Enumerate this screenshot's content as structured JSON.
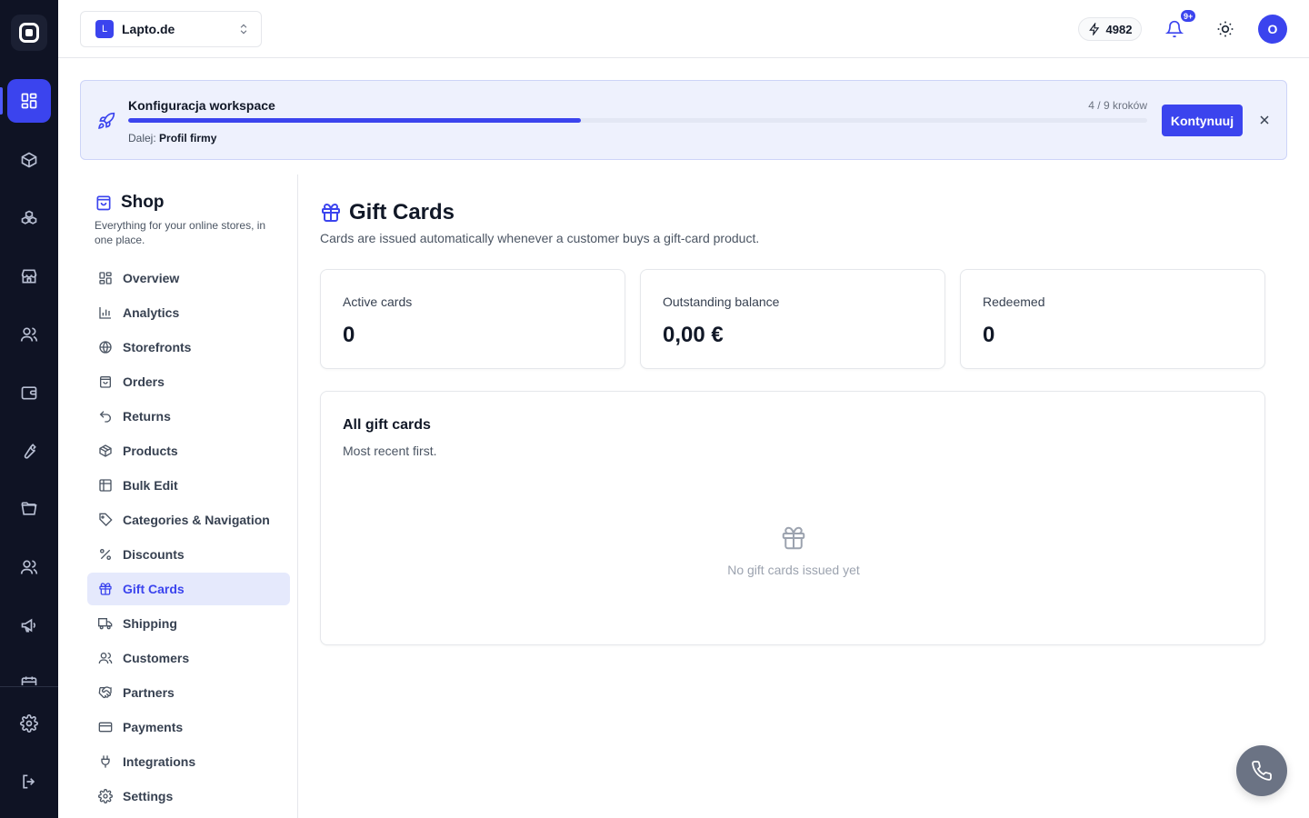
{
  "rail": {
    "items": [
      {
        "icon": "dashboard-icon",
        "active": true
      },
      {
        "icon": "cube-icon"
      },
      {
        "icon": "boxes-icon"
      },
      {
        "icon": "store-icon"
      },
      {
        "icon": "users-icon"
      },
      {
        "icon": "wallet-icon"
      },
      {
        "icon": "wrench-icon"
      },
      {
        "icon": "folder-icon"
      },
      {
        "icon": "team-icon"
      },
      {
        "icon": "megaphone-icon"
      }
    ],
    "bottom": [
      {
        "icon": "gear-icon"
      },
      {
        "icon": "logout-icon"
      }
    ]
  },
  "topbar": {
    "workspace_initial": "L",
    "workspace_name": "Lapto.de",
    "credits": "4982",
    "notifications_badge": "9+",
    "user_initial": "O"
  },
  "banner": {
    "title": "Konfiguracja workspace",
    "steps": "4 / 9 kroków",
    "progress": 0.444,
    "next_prefix": "Dalej:",
    "next_step": "Profil firmy",
    "cta": "Kontynuuj"
  },
  "subnav": {
    "title": "Shop",
    "description": "Everything for your online stores, in one place.",
    "items": [
      {
        "label": "Overview",
        "icon": "grid-icon"
      },
      {
        "label": "Analytics",
        "icon": "bar-chart-icon"
      },
      {
        "label": "Storefronts",
        "icon": "globe-icon"
      },
      {
        "label": "Orders",
        "icon": "shopping-bag-icon"
      },
      {
        "label": "Returns",
        "icon": "undo-icon"
      },
      {
        "label": "Products",
        "icon": "package-icon"
      },
      {
        "label": "Bulk Edit",
        "icon": "table-icon"
      },
      {
        "label": "Categories & Navigation",
        "icon": "tag-icon"
      },
      {
        "label": "Discounts",
        "icon": "percent-icon"
      },
      {
        "label": "Gift Cards",
        "icon": "gift-icon",
        "active": true
      },
      {
        "label": "Shipping",
        "icon": "truck-icon"
      },
      {
        "label": "Customers",
        "icon": "users-icon"
      },
      {
        "label": "Partners",
        "icon": "handshake-icon"
      },
      {
        "label": "Payments",
        "icon": "credit-card-icon"
      },
      {
        "label": "Integrations",
        "icon": "plug-icon"
      },
      {
        "label": "Settings",
        "icon": "gear-icon"
      }
    ]
  },
  "main": {
    "title": "Gift Cards",
    "subtitle": "Cards are issued automatically whenever a customer buys a gift-card product.",
    "stats": [
      {
        "label": "Active cards",
        "value": "0"
      },
      {
        "label": "Outstanding balance",
        "value": "0,00 €"
      },
      {
        "label": "Redeemed",
        "value": "0"
      }
    ],
    "list": {
      "title": "All gift cards",
      "subtitle": "Most recent first.",
      "empty_text": "No gift cards issued yet"
    }
  },
  "colors": {
    "accent": "#3b44ee",
    "rail_bg": "#0f1324",
    "banner_bg": "#eef1fd",
    "active_nav_bg": "#e5e9fc"
  }
}
